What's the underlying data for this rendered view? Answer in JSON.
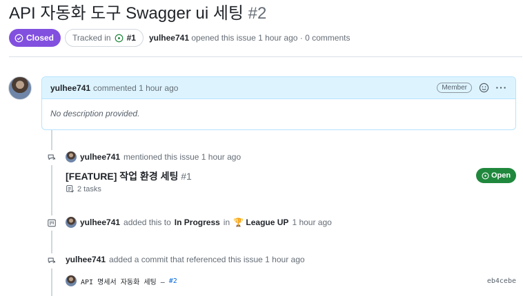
{
  "issue": {
    "title": "API 자동화 도구 Swagger ui 세팅",
    "number": "#2",
    "status": "Closed",
    "tracked_label": "Tracked in",
    "tracked_ref": "#1",
    "author": "yulhee741",
    "opened_text": "opened this issue 1 hour ago · 0 comments"
  },
  "comment": {
    "author": "yulhee741",
    "action": "commented 1 hour ago",
    "role_badge": "Member",
    "body": "No description provided."
  },
  "timeline": {
    "mention": {
      "author": "yulhee741",
      "action": "mentioned this issue 1 hour ago",
      "ref_title": "[FEATURE] 작업 환경 세팅",
      "ref_number": "#1",
      "tasks": "2 tasks",
      "ref_status": "Open"
    },
    "project": {
      "author": "yulhee741",
      "action_prefix": "added this to",
      "column": "In Progress",
      "in_word": "in",
      "project_name": "🏆 League UP",
      "time": "1 hour ago"
    },
    "commit": {
      "author": "yulhee741",
      "action": "added a commit that referenced this issue 1 hour ago",
      "message": "API 명세서 자동화 세팅 –",
      "issue_ref": "#2",
      "hash": "eb4cebe"
    }
  },
  "colors": {
    "closed": "#8250df",
    "open": "#1f883d",
    "comment_header": "#ddf4ff",
    "link": "#0969da"
  },
  "icons": {
    "closed_badge": "check-circle-icon",
    "tracked": "circle-dot-icon",
    "reaction": "smiley-icon",
    "more": "kebab-icon",
    "cross_reference": "cross-reference-icon",
    "tasks": "tasklist-icon",
    "project": "project-board-icon",
    "open_badge": "issue-opened-icon"
  }
}
